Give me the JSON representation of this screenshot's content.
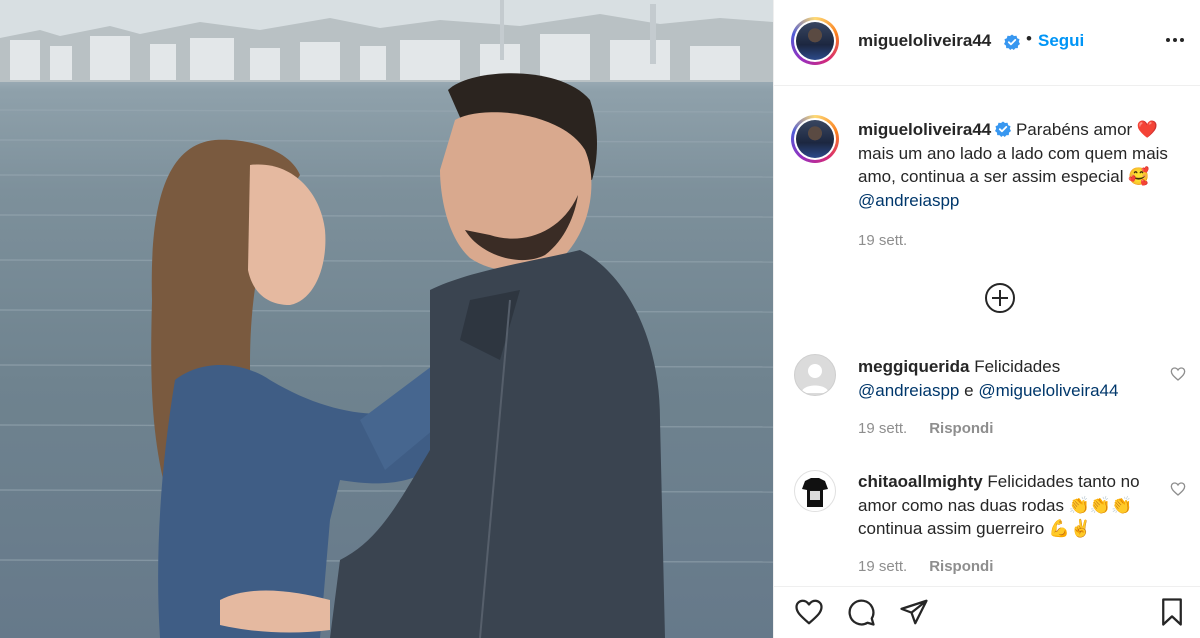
{
  "colors": {
    "accent": "#0095f6",
    "mention": "#00376b",
    "muted": "#8e8e8e",
    "verified": "#3897f0"
  },
  "header": {
    "username": "migueloliveira44",
    "separator": "•",
    "follow_label": "Segui",
    "more_icon": "more-options-icon"
  },
  "caption": {
    "username": "migueloliveira44",
    "text": "Parabéns amor ❤️ mais um ano lado a lado com quem mais amo, continua a ser assim especial 🥰",
    "mention": "@andreiaspp",
    "timestamp": "19 sett."
  },
  "load_more_icon": "plus-circle-icon",
  "comments": [
    {
      "username": "meggiquerida",
      "text_before": "Felicidades",
      "mention_1": "@andreiaspp",
      "joiner": "e",
      "mention_2": "@migueloliveira44",
      "timestamp": "19 sett.",
      "reply_label": "Rispondi"
    },
    {
      "username": "chitaoallmighty",
      "text": "Felicidades tanto no amor como nas duas rodas 👏👏👏 continua assim guerreiro 💪✌️",
      "timestamp": "19 sett.",
      "reply_label": "Rispondi"
    }
  ],
  "actions": [
    "heart-icon",
    "comment-icon",
    "share-icon",
    "bookmark-icon"
  ]
}
